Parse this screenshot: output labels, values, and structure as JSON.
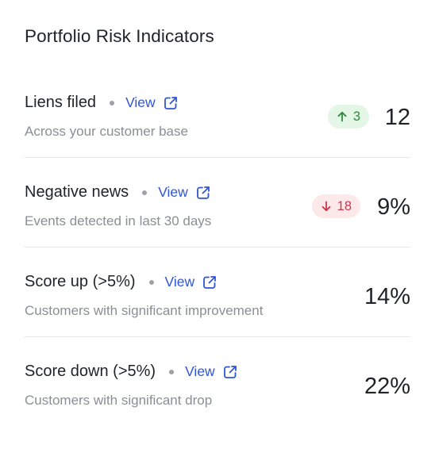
{
  "card": {
    "title": "Portfolio Risk Indicators"
  },
  "view_label": "View",
  "rows": [
    {
      "title": "Liens filed",
      "subtitle": "Across your customer base",
      "value": "12",
      "badge": {
        "direction": "up",
        "text": "3"
      }
    },
    {
      "title": "Negative news",
      "subtitle": "Events detected in last 30 days",
      "value": "9%",
      "badge": {
        "direction": "down",
        "text": "18"
      }
    },
    {
      "title": "Score up (>5%)",
      "subtitle": "Customers with significant improvement",
      "value": "14%",
      "badge": null
    },
    {
      "title": "Score down (>5%)",
      "subtitle": "Customers with significant drop",
      "value": "22%",
      "badge": null
    }
  ],
  "colors": {
    "link": "#2f55d4",
    "badge_up_bg": "#e4f6e6",
    "badge_up_text": "#2e8b3e",
    "badge_down_bg": "#fde8ea",
    "badge_down_text": "#d0364b"
  },
  "icons": {
    "view_link": "external-link-icon",
    "badge_up": "arrow-up-icon",
    "badge_down": "arrow-down-icon"
  }
}
